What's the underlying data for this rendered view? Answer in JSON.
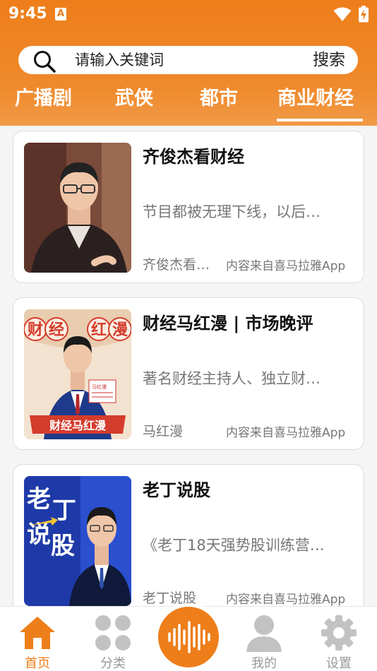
{
  "status": {
    "time": "9:45",
    "a_badge": "A"
  },
  "search": {
    "placeholder": "请输入关键词",
    "button_label": "搜索"
  },
  "tabs": [
    {
      "label": "广播剧"
    },
    {
      "label": "武侠"
    },
    {
      "label": "都市"
    },
    {
      "label": "商业财经",
      "active": true
    }
  ],
  "cards": [
    {
      "title": "齐俊杰看财经",
      "desc": "节目都被无理下线，以后…",
      "author": "齐俊杰看…",
      "source": "内容来自喜马拉雅App"
    },
    {
      "title": "财经马红漫 | 市场晚评",
      "desc": "著名财经主持人、独立财…",
      "author": "马红漫",
      "source": "内容来自喜马拉雅App",
      "cover_text": "财经马红漫",
      "cover_chars": [
        "财",
        "经",
        "马",
        "红",
        "漫"
      ],
      "badge_name": "马红漫"
    },
    {
      "title": "老丁说股",
      "desc": "《老丁18天强势股训练营…",
      "author": "老丁说股",
      "source": "内容来自喜马拉雅App",
      "cover_chars": [
        "老",
        "丁",
        "说",
        "股"
      ]
    }
  ],
  "nav": [
    {
      "label": "首页",
      "icon": "home-icon",
      "active": true
    },
    {
      "label": "分类",
      "icon": "grid-icon"
    },
    {
      "label": "我的",
      "icon": "user-icon"
    },
    {
      "label": "设置",
      "icon": "gear-icon"
    }
  ],
  "colors": {
    "accent": "#ee7e1a",
    "nav_inactive": "#999999",
    "text_secondary": "#777777"
  }
}
